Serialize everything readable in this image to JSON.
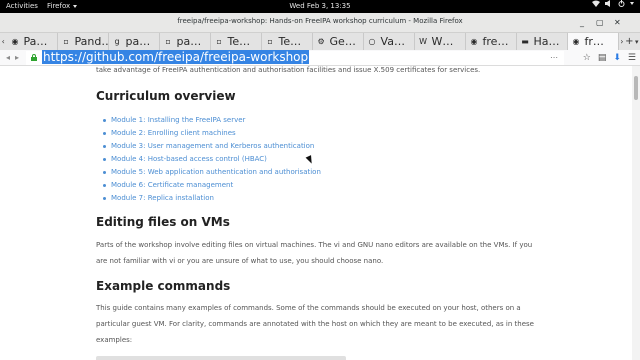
{
  "topbar": {
    "activities": "Activities",
    "app": "Firefox",
    "clock": "Wed Feb 3, 13:35"
  },
  "window": {
    "title": "freeipa/freeipa-workshop: Hands-on FreeIPA workshop curriculum - Mozilla Firefox"
  },
  "tabs": [
    {
      "label": "Pa…",
      "icon": "github-icon"
    },
    {
      "label": "Pand…",
      "icon": "page-icon"
    },
    {
      "label": "pa…",
      "icon": "google-icon"
    },
    {
      "label": "pa…",
      "icon": "page-icon"
    },
    {
      "label": "Te…",
      "icon": "page-icon"
    },
    {
      "label": "Te…",
      "icon": "page-icon"
    },
    {
      "label": "Ge…",
      "icon": "gear-icon"
    },
    {
      "label": "Va…",
      "icon": "circle-icon"
    },
    {
      "label": "W…",
      "icon": "wikipedia-icon"
    },
    {
      "label": "fre…",
      "icon": "github-icon"
    },
    {
      "label": "Ha…",
      "icon": "dash-icon"
    },
    {
      "label": "fr…",
      "icon": "github-icon",
      "active": true
    }
  ],
  "navbar": {
    "url": "https://github.com/freeipa/freeipa-workshop",
    "dots": "⋯"
  },
  "content": {
    "cut_text": "take advantage of FreeIPA authentication and authorisation facilities and issue X.509 certificates for services.",
    "curriculum_heading": "Curriculum overview",
    "modules": [
      "Module 1: Installing the FreeIPA server",
      "Module 2: Enrolling client machines",
      "Module 3: User management and Kerberos authentication",
      "Module 4: Host-based access control (HBAC)",
      "Module 5: Web application authentication and authorisation",
      "Module 6: Certificate management",
      "Module 7: Replica installation"
    ],
    "editing_heading": "Editing files on VMs",
    "editing_text": "Parts of the workshop involve editing files on virtual machines. The vi and GNU nano editors are available on the VMs. If you are not familiar with vi or you are unsure of what to use, you should choose nano.",
    "examples_heading": "Example commands",
    "examples_text": "This guide contains many examples of commands. Some of the commands should be executed on your host, others on a particular guest VM. For clarity, commands are annotated with the host on which they are meant to be executed, as in these examples:"
  }
}
